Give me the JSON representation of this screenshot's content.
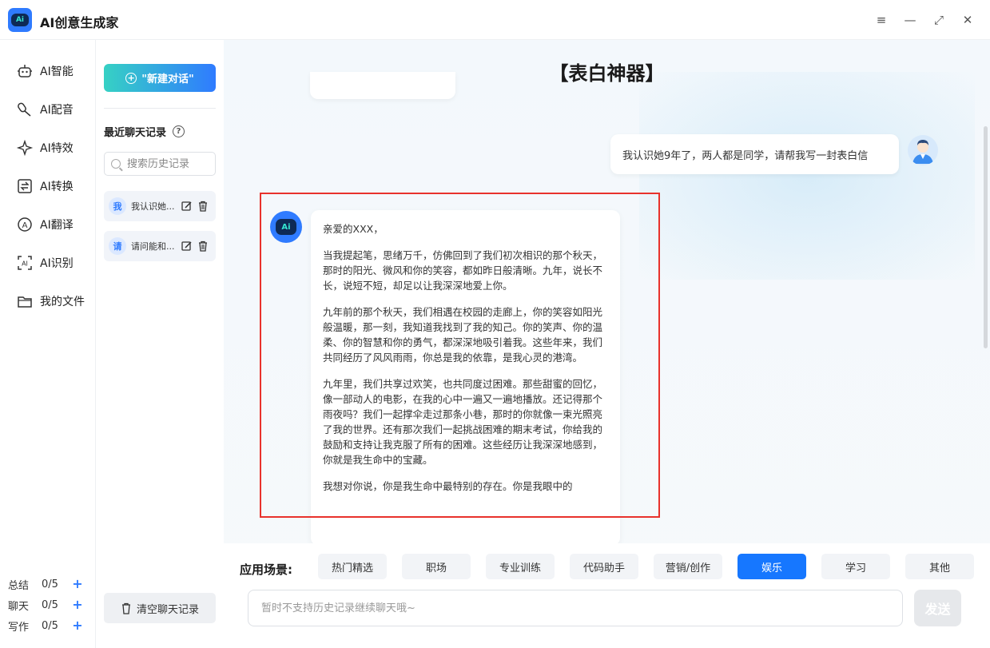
{
  "app": {
    "title": "AI创意生成家"
  },
  "window": {
    "menu": "≡",
    "minimize": "—",
    "maximize": "⤢",
    "close": "✕"
  },
  "nav": {
    "items": [
      {
        "label": "AI智能"
      },
      {
        "label": "AI配音"
      },
      {
        "label": "AI特效"
      },
      {
        "label": "AI转换"
      },
      {
        "label": "AI翻译"
      },
      {
        "label": "AI识别"
      },
      {
        "label": "我的文件"
      }
    ],
    "quotas": [
      {
        "label": "总结",
        "value": "0/5"
      },
      {
        "label": "聊天",
        "value": "0/5"
      },
      {
        "label": "写作",
        "value": "0/5"
      }
    ]
  },
  "history": {
    "new_chat": "\"新建对话\"",
    "recent_title": "最近聊天记录",
    "search_placeholder": "搜索历史记录",
    "items": [
      {
        "badge": "我",
        "text": "我认识她..."
      },
      {
        "badge": "请",
        "text": "请问能和..."
      }
    ],
    "clear_label": "清空聊天记录"
  },
  "main": {
    "title": "【表白神器】",
    "user_message": "我认识她9年了，两人都是同学，请帮我写一封表白信",
    "bot_message": [
      "亲爱的XXX，",
      "当我提起笔，思绪万千，仿佛回到了我们初次相识的那个秋天，那时的阳光、微风和你的笑容，都如昨日般清晰。九年，说长不长，说短不短，却足以让我深深地爱上你。",
      "九年前的那个秋天，我们相遇在校园的走廊上，你的笑容如阳光般温暖，那一刻，我知道我找到了我的知己。你的笑声、你的温柔、你的智慧和你的勇气，都深深地吸引着我。这些年来，我们共同经历了风风雨雨，你总是我的依靠，是我心灵的港湾。",
      "九年里，我们共享过欢笑，也共同度过困难。那些甜蜜的回忆，像一部动人的电影，在我的心中一遍又一遍地播放。还记得那个雨夜吗？我们一起撑伞走过那条小巷，那时的你就像一束光照亮了我的世界。还有那次我们一起挑战困难的期末考试，你给我的鼓励和支持让我克服了所有的困难。这些经历让我深深地感到，你就是我生命中的宝藏。",
      "我想对你说，你是我生命中最特别的存在。你是我眼中的"
    ]
  },
  "bottom": {
    "scene_label": "应用场景:",
    "tabs": [
      "热门精选",
      "职场",
      "专业训练",
      "代码助手",
      "营销/创作",
      "娱乐",
      "学习",
      "其他"
    ],
    "active_tab": "娱乐",
    "input_placeholder": "暂时不支持历史记录继续聊天哦~",
    "send_label": "发送"
  },
  "colors": {
    "accent": "#1677ff",
    "highlight": "#e8322c",
    "logo": "#2f7bff"
  }
}
